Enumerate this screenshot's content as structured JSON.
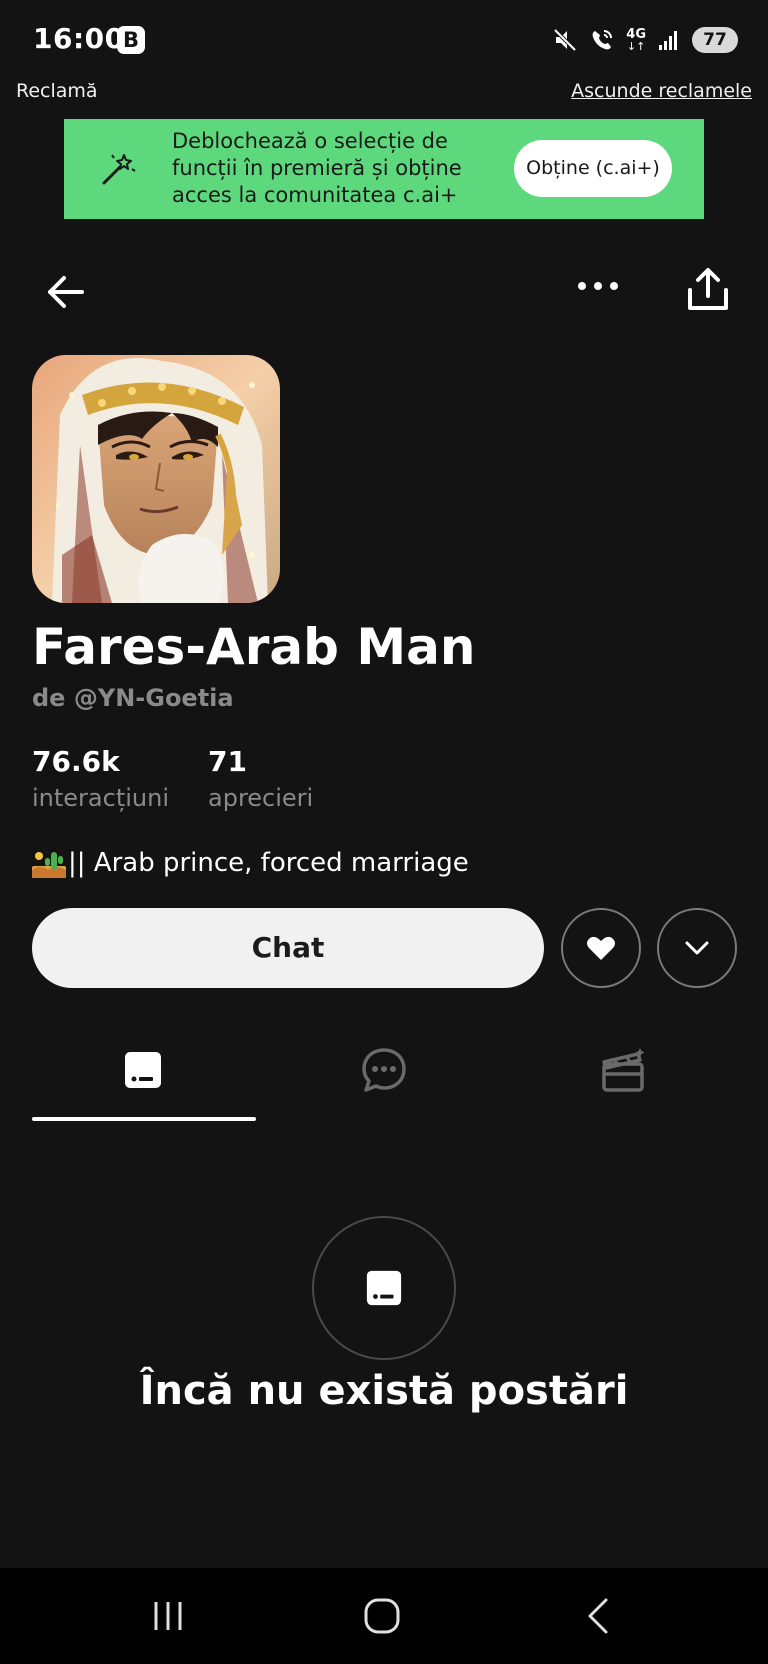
{
  "status_bar": {
    "time": "16:00",
    "app_badge": "B",
    "network": "4G",
    "battery": "77"
  },
  "ad": {
    "label": "Reclamă",
    "hide_link": "Ascunde reclamele"
  },
  "promo": {
    "text": "Deblochează o selecție de funcții în premieră și obține acces la comunitatea c.ai+",
    "button": "Obține (c.ai+)",
    "background": "#5ed87d"
  },
  "character": {
    "name": "Fares-Arab Man",
    "author": "de @YN-Goetia",
    "tagline": "|| Arab prince, forced marriage",
    "tagline_emoji": "desert-cactus-emoji"
  },
  "stats": [
    {
      "value": "76.6k",
      "label": "interacțiuni"
    },
    {
      "value": "71",
      "label": "aprecieri"
    }
  ],
  "actions": {
    "chat": "Chat",
    "like_icon": "heart-icon",
    "expand_icon": "chevron-down-icon"
  },
  "tabs": [
    {
      "icon": "posts-icon",
      "active": true
    },
    {
      "icon": "chat-bubble-icon",
      "active": false
    },
    {
      "icon": "clapperboard-icon",
      "active": false
    }
  ],
  "empty_state": {
    "text": "Încă nu există postări"
  }
}
